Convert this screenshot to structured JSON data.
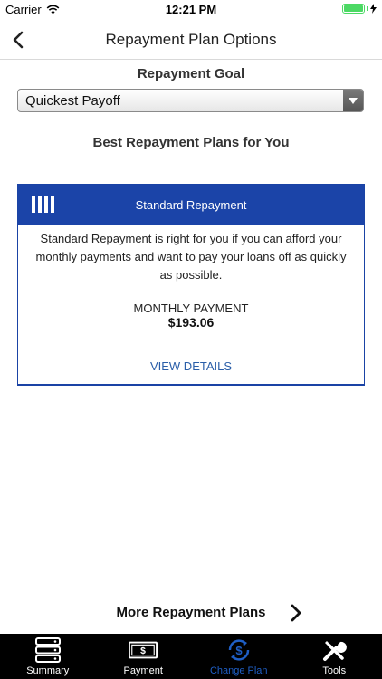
{
  "status_bar": {
    "carrier": "Carrier",
    "time": "12:21 PM"
  },
  "nav": {
    "title": "Repayment Plan Options"
  },
  "repayment_goal": {
    "label": "Repayment Goal",
    "selected": "Quickest Payoff"
  },
  "best_plans": {
    "heading": "Best Repayment Plans for You"
  },
  "plan_card": {
    "title": "Standard Repayment",
    "description": "Standard Repayment is right for you if you can afford your monthly payments and want to pay your loans off as quickly as possible.",
    "monthly_payment_label": "MONTHLY PAYMENT",
    "monthly_payment_value": "$193.06",
    "view_details": "VIEW DETAILS"
  },
  "more_plans": {
    "label": "More Repayment Plans"
  },
  "tab_bar": {
    "tabs": [
      {
        "label": "Summary",
        "icon": "summary-icon"
      },
      {
        "label": "Payment",
        "icon": "payment-icon"
      },
      {
        "label": "Change Plan",
        "icon": "change-plan-icon",
        "active": true
      },
      {
        "label": "Tools",
        "icon": "tools-icon"
      }
    ]
  },
  "colors": {
    "accent_blue": "#1b44a8",
    "link_blue": "#2a5ea8",
    "active_tab": "#1f5fc6",
    "battery_green": "#4cd964"
  }
}
